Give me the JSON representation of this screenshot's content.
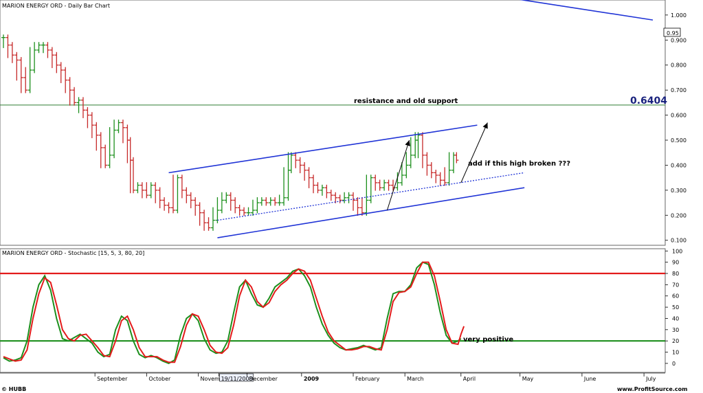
{
  "chart_data": [
    {
      "type": "bar",
      "title": "MARION ENERGY ORD - Daily Bar Chart",
      "y_ticks": [
        "0.100",
        "0.200",
        "0.300",
        "0.400",
        "0.500",
        "0.600",
        "0.700",
        "0.800",
        "0.900",
        "1.000"
      ],
      "ylim": [
        0.08,
        1.06
      ],
      "last_price_label": "0.95",
      "horizontal_level": {
        "value": 0.6404,
        "label": "0.6404",
        "color": "#2e7d32"
      },
      "annotations": [
        "resistance and old support",
        "add if this high broken  ???"
      ],
      "x_labels": [
        "September",
        "October",
        "Novem",
        "19/11/2008",
        "December",
        "2009",
        "February",
        "March",
        "April",
        "May",
        "June",
        "July"
      ],
      "x_label_days": [
        62,
        97,
        132,
        146,
        165,
        202,
        237,
        272,
        310,
        350,
        392,
        434
      ],
      "close_series": [
        [
          0,
          0.91
        ],
        [
          3,
          0.88
        ],
        [
          6,
          0.84
        ],
        [
          9,
          0.82
        ],
        [
          12,
          0.75
        ],
        [
          15,
          0.7
        ],
        [
          18,
          0.78
        ],
        [
          21,
          0.86
        ],
        [
          24,
          0.88
        ],
        [
          27,
          0.88
        ],
        [
          30,
          0.86
        ],
        [
          33,
          0.84
        ],
        [
          36,
          0.8
        ],
        [
          39,
          0.78
        ],
        [
          42,
          0.74
        ],
        [
          45,
          0.7
        ],
        [
          48,
          0.65
        ],
        [
          51,
          0.66
        ],
        [
          54,
          0.62
        ],
        [
          57,
          0.6
        ],
        [
          60,
          0.56
        ],
        [
          63,
          0.52
        ],
        [
          66,
          0.47
        ],
        [
          69,
          0.4
        ],
        [
          72,
          0.44
        ],
        [
          75,
          0.54
        ],
        [
          78,
          0.57
        ],
        [
          81,
          0.55
        ],
        [
          84,
          0.5
        ],
        [
          86,
          0.42
        ],
        [
          88,
          0.3
        ],
        [
          91,
          0.32
        ],
        [
          94,
          0.3
        ],
        [
          97,
          0.28
        ],
        [
          100,
          0.32
        ],
        [
          103,
          0.3
        ],
        [
          106,
          0.26
        ],
        [
          109,
          0.24
        ],
        [
          112,
          0.23
        ],
        [
          115,
          0.22
        ],
        [
          118,
          0.35
        ],
        [
          121,
          0.3
        ],
        [
          124,
          0.28
        ],
        [
          127,
          0.26
        ],
        [
          130,
          0.24
        ],
        [
          133,
          0.21
        ],
        [
          136,
          0.17
        ],
        [
          139,
          0.15
        ],
        [
          142,
          0.18
        ],
        [
          145,
          0.22
        ],
        [
          148,
          0.26
        ],
        [
          151,
          0.28
        ],
        [
          154,
          0.26
        ],
        [
          157,
          0.23
        ],
        [
          160,
          0.22
        ],
        [
          163,
          0.21
        ],
        [
          166,
          0.21
        ],
        [
          169,
          0.22
        ],
        [
          172,
          0.25
        ],
        [
          175,
          0.26
        ],
        [
          178,
          0.25
        ],
        [
          181,
          0.26
        ],
        [
          184,
          0.25
        ],
        [
          187,
          0.25
        ],
        [
          190,
          0.27
        ],
        [
          193,
          0.38
        ],
        [
          195,
          0.44
        ],
        [
          198,
          0.42
        ],
        [
          201,
          0.4
        ],
        [
          204,
          0.38
        ],
        [
          207,
          0.35
        ],
        [
          210,
          0.32
        ],
        [
          213,
          0.3
        ],
        [
          216,
          0.31
        ],
        [
          219,
          0.29
        ],
        [
          222,
          0.28
        ],
        [
          225,
          0.27
        ],
        [
          228,
          0.26
        ],
        [
          231,
          0.27
        ],
        [
          234,
          0.28
        ],
        [
          237,
          0.26
        ],
        [
          240,
          0.23
        ],
        [
          243,
          0.21
        ],
        [
          246,
          0.26
        ],
        [
          249,
          0.35
        ],
        [
          252,
          0.33
        ],
        [
          255,
          0.31
        ],
        [
          258,
          0.33
        ],
        [
          261,
          0.32
        ],
        [
          264,
          0.31
        ],
        [
          267,
          0.33
        ],
        [
          270,
          0.36
        ],
        [
          273,
          0.4
        ],
        [
          276,
          0.44
        ],
        [
          279,
          0.5
        ],
        [
          281,
          0.52
        ],
        [
          284,
          0.44
        ],
        [
          287,
          0.4
        ],
        [
          290,
          0.37
        ],
        [
          293,
          0.36
        ],
        [
          296,
          0.34
        ],
        [
          299,
          0.33
        ],
        [
          302,
          0.38
        ],
        [
          305,
          0.44
        ],
        [
          307,
          0.42
        ]
      ],
      "channel_lines": [
        {
          "style": "solid",
          "color": "#1f33d6",
          "x": [
            112,
            321
          ],
          "y": [
            0.37,
            0.56
          ]
        },
        {
          "style": "solid",
          "color": "#1f33d6",
          "x": [
            145,
            353
          ],
          "y": [
            0.11,
            0.31
          ]
        },
        {
          "style": "dotted",
          "color": "#1f33d6",
          "x": [
            145,
            353
          ],
          "y": [
            0.18,
            0.37
          ]
        },
        {
          "style": "solid",
          "color": "#1f33d6",
          "x": [
            330,
            440
          ],
          "y": [
            1.08,
            0.98
          ]
        }
      ],
      "arrows": [
        {
          "from": [
            260,
            0.22
          ],
          "to": [
            275,
            0.5
          ]
        },
        {
          "from": [
            310,
            0.33
          ],
          "to": [
            328,
            0.57
          ]
        }
      ],
      "grid": false
    },
    {
      "type": "line",
      "title": "MARION ENERGY ORD - Stochastic [15, 5, 3, 80, 20]",
      "y_ticks": [
        "0",
        "10",
        "20",
        "30",
        "40",
        "50",
        "60",
        "70",
        "80",
        "90",
        "100"
      ],
      "ylim": [
        -8,
        102
      ],
      "reference_levels": [
        {
          "value": 80,
          "color": "#e31b1b"
        },
        {
          "value": 20,
          "color": "#1c8f1c"
        }
      ],
      "annotations": [
        "very positive"
      ],
      "series": [
        {
          "color": "#1c8f1c",
          "values": [
            [
              0,
              5
            ],
            [
              4,
              2
            ],
            [
              8,
              3
            ],
            [
              12,
              5
            ],
            [
              16,
              20
            ],
            [
              20,
              50
            ],
            [
              24,
              70
            ],
            [
              28,
              78
            ],
            [
              32,
              65
            ],
            [
              36,
              40
            ],
            [
              40,
              22
            ],
            [
              44,
              20
            ],
            [
              48,
              23
            ],
            [
              52,
              26
            ],
            [
              56,
              22
            ],
            [
              60,
              18
            ],
            [
              64,
              10
            ],
            [
              68,
              6
            ],
            [
              72,
              8
            ],
            [
              76,
              30
            ],
            [
              80,
              42
            ],
            [
              84,
              38
            ],
            [
              88,
              20
            ],
            [
              92,
              8
            ],
            [
              96,
              5
            ],
            [
              100,
              7
            ],
            [
              104,
              5
            ],
            [
              108,
              2
            ],
            [
              112,
              0
            ],
            [
              116,
              3
            ],
            [
              120,
              25
            ],
            [
              124,
              40
            ],
            [
              128,
              44
            ],
            [
              132,
              38
            ],
            [
              136,
              22
            ],
            [
              140,
              12
            ],
            [
              144,
              9
            ],
            [
              148,
              10
            ],
            [
              152,
              20
            ],
            [
              156,
              45
            ],
            [
              160,
              68
            ],
            [
              164,
              74
            ],
            [
              168,
              62
            ],
            [
              172,
              52
            ],
            [
              176,
              50
            ],
            [
              180,
              58
            ],
            [
              184,
              68
            ],
            [
              188,
              72
            ],
            [
              192,
              76
            ],
            [
              196,
              82
            ],
            [
              200,
              84
            ],
            [
              204,
              78
            ],
            [
              208,
              68
            ],
            [
              212,
              50
            ],
            [
              216,
              35
            ],
            [
              220,
              25
            ],
            [
              224,
              18
            ],
            [
              228,
              14
            ],
            [
              232,
              12
            ],
            [
              236,
              13
            ],
            [
              240,
              14
            ],
            [
              244,
              16
            ],
            [
              248,
              14
            ],
            [
              252,
              12
            ],
            [
              256,
              14
            ],
            [
              260,
              40
            ],
            [
              264,
              62
            ],
            [
              268,
              64
            ],
            [
              272,
              64
            ],
            [
              276,
              70
            ],
            [
              280,
              85
            ],
            [
              284,
              90
            ],
            [
              288,
              88
            ],
            [
              292,
              70
            ],
            [
              296,
              45
            ],
            [
              300,
              25
            ],
            [
              304,
              18
            ],
            [
              308,
              20
            ],
            [
              310,
              22
            ]
          ]
        },
        {
          "color": "#e31b1b",
          "values": [
            [
              0,
              6
            ],
            [
              4,
              4
            ],
            [
              8,
              2
            ],
            [
              12,
              3
            ],
            [
              16,
              12
            ],
            [
              20,
              40
            ],
            [
              24,
              62
            ],
            [
              28,
              76
            ],
            [
              32,
              72
            ],
            [
              36,
              52
            ],
            [
              40,
              30
            ],
            [
              44,
              22
            ],
            [
              48,
              20
            ],
            [
              52,
              25
            ],
            [
              56,
              26
            ],
            [
              60,
              20
            ],
            [
              64,
              14
            ],
            [
              68,
              7
            ],
            [
              72,
              6
            ],
            [
              76,
              20
            ],
            [
              80,
              38
            ],
            [
              84,
              42
            ],
            [
              88,
              30
            ],
            [
              92,
              14
            ],
            [
              96,
              6
            ],
            [
              100,
              6
            ],
            [
              104,
              6
            ],
            [
              108,
              3
            ],
            [
              112,
              1
            ],
            [
              116,
              1
            ],
            [
              120,
              15
            ],
            [
              124,
              34
            ],
            [
              128,
              44
            ],
            [
              132,
              42
            ],
            [
              136,
              30
            ],
            [
              140,
              16
            ],
            [
              144,
              10
            ],
            [
              148,
              9
            ],
            [
              152,
              14
            ],
            [
              156,
              34
            ],
            [
              160,
              60
            ],
            [
              164,
              74
            ],
            [
              168,
              68
            ],
            [
              172,
              55
            ],
            [
              176,
              50
            ],
            [
              180,
              54
            ],
            [
              184,
              64
            ],
            [
              188,
              70
            ],
            [
              192,
              74
            ],
            [
              196,
              80
            ],
            [
              200,
              84
            ],
            [
              204,
              82
            ],
            [
              208,
              74
            ],
            [
              212,
              58
            ],
            [
              216,
              42
            ],
            [
              220,
              28
            ],
            [
              224,
              20
            ],
            [
              228,
              16
            ],
            [
              232,
              12
            ],
            [
              236,
              12
            ],
            [
              240,
              13
            ],
            [
              244,
              15
            ],
            [
              248,
              15
            ],
            [
              252,
              13
            ],
            [
              256,
              12
            ],
            [
              260,
              30
            ],
            [
              264,
              55
            ],
            [
              268,
              63
            ],
            [
              272,
              64
            ],
            [
              276,
              68
            ],
            [
              280,
              80
            ],
            [
              284,
              90
            ],
            [
              288,
              90
            ],
            [
              292,
              78
            ],
            [
              296,
              55
            ],
            [
              300,
              30
            ],
            [
              304,
              18
            ],
            [
              308,
              17
            ],
            [
              310,
              26
            ],
            [
              312,
              33
            ]
          ]
        }
      ],
      "grid": false
    }
  ],
  "footer": {
    "left": "© HUBB",
    "right": "www.ProfitSource.com"
  }
}
